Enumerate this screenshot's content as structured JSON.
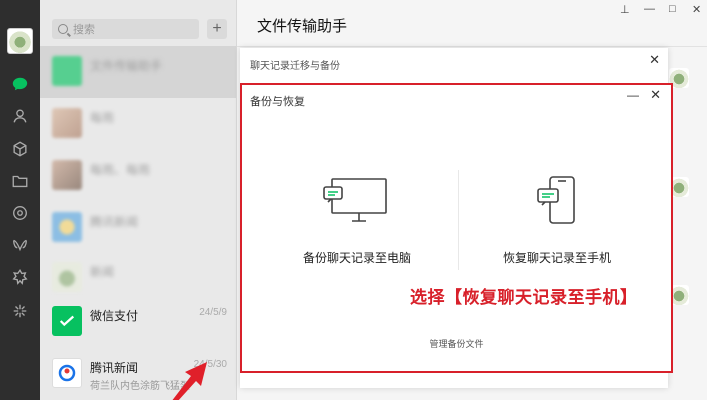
{
  "search": {
    "placeholder": "搜索"
  },
  "add_button": {
    "label": "+"
  },
  "chats": [
    {
      "name": "文件传输助手",
      "sub": "",
      "time": "",
      "blurred": true,
      "active": true
    },
    {
      "name": "每雨",
      "sub": "",
      "time": "",
      "blurred": true
    },
    {
      "name": "每雨、每雨",
      "sub": "",
      "time": "",
      "blurred": true
    },
    {
      "name": "腾讯新闻",
      "sub": "",
      "time": "",
      "blurred": true
    },
    {
      "name": "新闻",
      "sub": "",
      "time": "",
      "blurred": true
    },
    {
      "name": "微信支付",
      "sub": "",
      "time": "24/5/9",
      "blurred": false
    },
    {
      "name": "腾讯新闻",
      "sub": "荷兰队内色涂筋飞猛烈",
      "time": "24/5/30",
      "blurred": false
    }
  ],
  "main": {
    "title": "文件传输助手",
    "pin_icon": "⊥",
    "min_icon": "—",
    "max_icon": "□",
    "close_icon": "✕"
  },
  "migrate_dialog": {
    "title": "聊天记录迁移与备份",
    "close_icon": "✕"
  },
  "backup_dialog": {
    "title": "备份与恢复",
    "min_icon": "—",
    "close_icon": "✕",
    "option_pc": "备份聊天记录至电脑",
    "option_phone": "恢复聊天记录至手机",
    "manage_link": "管理备份文件"
  },
  "callout": "选择【恢复聊天记录至手机】",
  "colors": {
    "highlight_red": "#d8202a",
    "wechat_green": "#07c160",
    "rail_bg": "#2e2e2e"
  }
}
